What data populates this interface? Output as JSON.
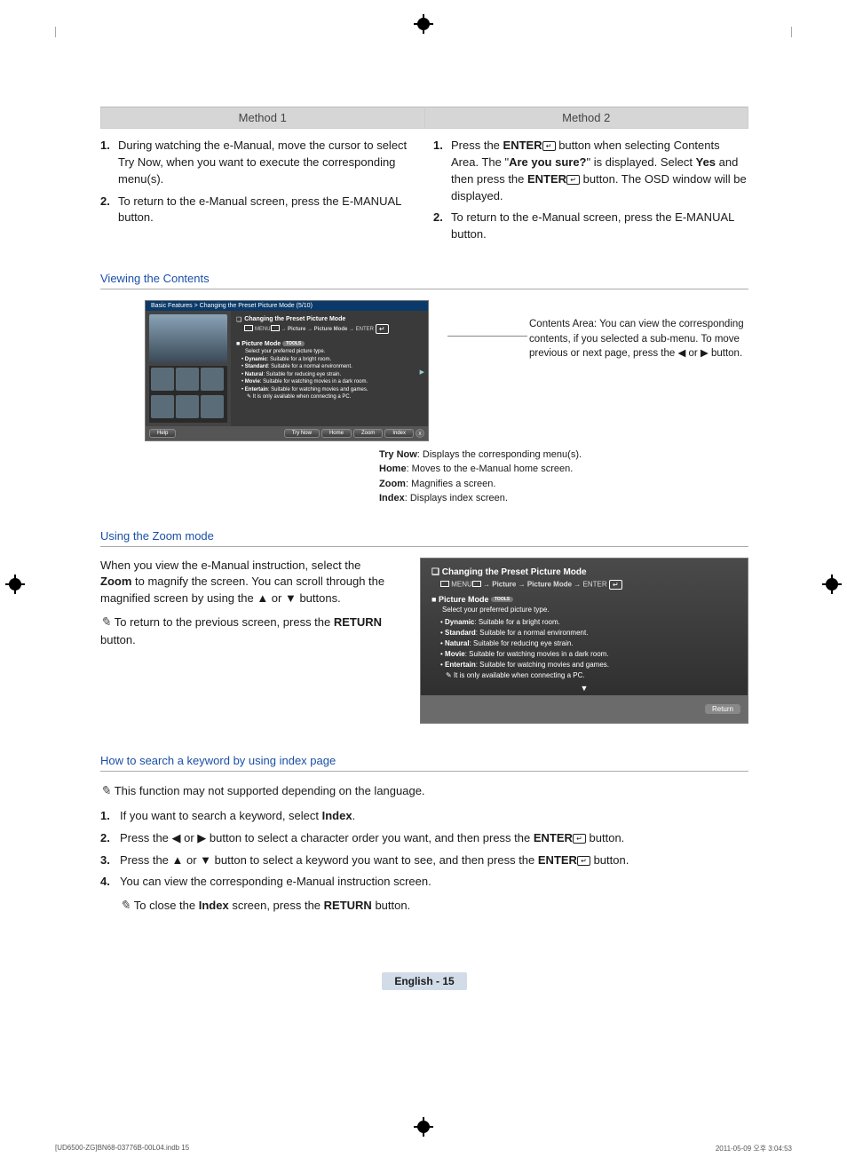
{
  "methods": {
    "m1": "Method 1",
    "m2": "Method 2"
  },
  "left": {
    "s1": "During watching the e-Manual, move the cursor to select Try Now, when you want to execute the corresponding menu(s).",
    "s2": "To return to the e-Manual screen, press the E-MANUAL button."
  },
  "right": {
    "s1_a": "Press the ",
    "s1_b": "ENTER",
    "s1_c": " button when selecting Contents Area. The \"",
    "s1_d": "Are you sure?",
    "s1_e": "\" is displayed. Select ",
    "s1_f": "Yes",
    "s1_g": " and then press the ",
    "s1_h": "ENTER",
    "s1_i": " button. The OSD window will be displayed.",
    "s2": "To return to the e-Manual screen, press the E-MANUAL button."
  },
  "viewing_title": "Viewing the Contents",
  "eman": {
    "header": "Basic Features > Changing the Preset Picture Mode (5/10)",
    "title": "Changing the Preset Picture Mode",
    "path": "MENU → Picture → Picture Mode → ENTER",
    "picmode": "Picture Mode",
    "tools": "TOOLS",
    "select": "Select your preferred picture type.",
    "items": [
      {
        "b": "Dynamic",
        "t": ": Suitable for a bright room."
      },
      {
        "b": "Standard",
        "t": ": Suitable for a normal environment."
      },
      {
        "b": "Natural",
        "t": ": Suitable for reducing eye strain."
      },
      {
        "b": "Movie",
        "t": ": Suitable for watching movies in a dark room."
      },
      {
        "b": "Entertain",
        "t": ": Suitable for watching movies and games."
      }
    ],
    "note": "It is only available when connecting a PC.",
    "help": "Help",
    "trynow": "Try Now",
    "home": "Home",
    "zoom": "Zoom",
    "index": "Index",
    "x": "X"
  },
  "callout": "Contents Area: You can view the corresponding contents, if you selected a sub-menu. To move previous or next page, press the ◀ or ▶ button.",
  "caps": {
    "c1a": "Try Now",
    "c1b": ": Displays the corresponding menu(s).",
    "c2a": "Home",
    "c2b": ": Moves to the e-Manual home screen.",
    "c3a": "Zoom",
    "c3b": ": Magnifies a screen.",
    "c4a": "Index",
    "c4b": ": Displays index screen."
  },
  "zoom_title": "Using the Zoom mode",
  "zoom_p1_a": "When you view the e-Manual instruction, select the ",
  "zoom_p1_b": "Zoom",
  "zoom_p1_c": " to magnify the screen. You can scroll through the magnified screen by using the ▲ or ▼ buttons.",
  "zoom_p2_a": "To return to the previous screen, press the ",
  "zoom_p2_b": "RETURN",
  "zoom_p2_c": " button.",
  "zb": {
    "return": "Return"
  },
  "index_title": "How to search a keyword by using index page",
  "index_note": "This function may not supported depending on the language.",
  "index": {
    "s1_a": "If you want to search a keyword, select ",
    "s1_b": "Index",
    "s1_c": ".",
    "s2_a": "Press the ◀ or ▶ button to select a character order you want, and then press the ",
    "s2_b": "ENTER",
    "s2_c": " button.",
    "s3_a": "Press the ▲ or ▼ button to select a keyword you want to see, and then press the ",
    "s3_b": "ENTER",
    "s3_c": " button.",
    "s4": "You can view the corresponding e-Manual instruction screen.",
    "s5_a": "To close the ",
    "s5_b": "Index",
    "s5_c": " screen, press the ",
    "s5_d": "RETURN",
    "s5_e": " button."
  },
  "pgnum": "English - 15",
  "footer": {
    "l": "[UD6500-ZG]BN68-03776B-00L04.indb   15",
    "r": "2011-05-09   오후 3:04:53"
  }
}
